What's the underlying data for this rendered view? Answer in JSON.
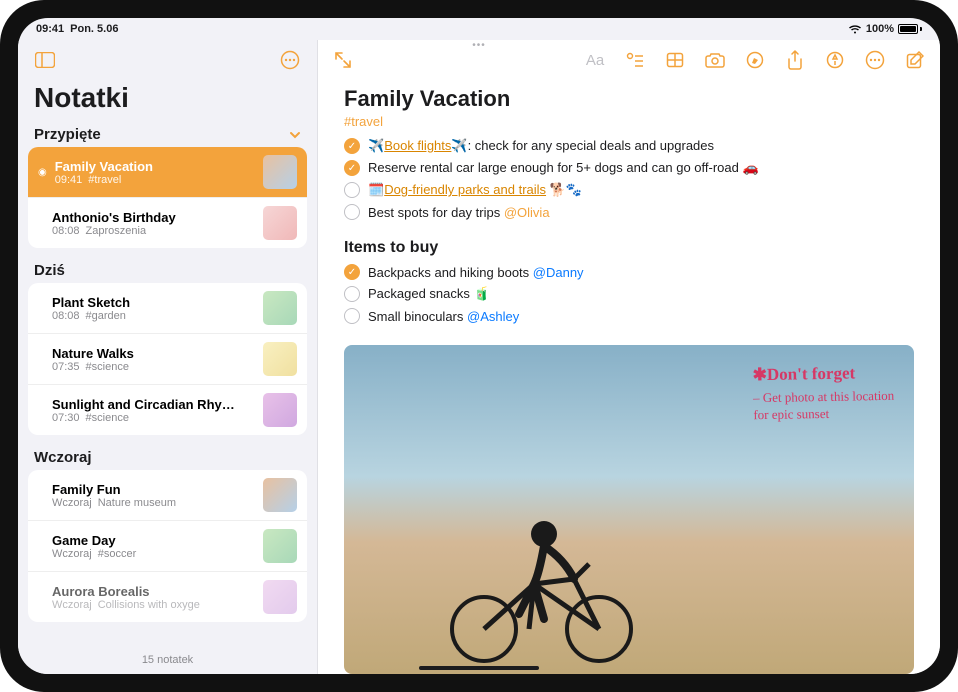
{
  "statusbar": {
    "time": "09:41",
    "date": "Pon. 5.06",
    "battery": "100%"
  },
  "sidebar": {
    "title": "Notatki",
    "sections": [
      {
        "header": "Przypięte",
        "items": [
          {
            "title": "Family Vacation",
            "time": "09:41",
            "preview": "#travel",
            "pinned": true,
            "selected": true
          },
          {
            "title": "Anthonio's Birthday",
            "time": "08:08",
            "preview": "Zaproszenia"
          }
        ]
      },
      {
        "header": "Dziś",
        "items": [
          {
            "title": "Plant Sketch",
            "time": "08:08",
            "preview": "#garden"
          },
          {
            "title": "Nature Walks",
            "time": "07:35",
            "preview": "#science"
          },
          {
            "title": "Sunlight and Circadian Rhy…",
            "time": "07:30",
            "preview": "#science"
          }
        ]
      },
      {
        "header": "Wczoraj",
        "items": [
          {
            "title": "Family Fun",
            "time": "Wczoraj",
            "preview": "Nature museum"
          },
          {
            "title": "Game Day",
            "time": "Wczoraj",
            "preview": "#soccer"
          },
          {
            "title": "Aurora Borealis",
            "time": "Wczoraj",
            "preview": "Collisions with oxyge"
          }
        ]
      }
    ],
    "footer": "15 notatek"
  },
  "note": {
    "title": "Family Vacation",
    "tag": "#travel",
    "checklist1": [
      {
        "done": true,
        "prefix": "✈️",
        "link": "Book flights",
        "suffix_emoji": "✈️",
        "rest": ": check for any special deals and upgrades"
      },
      {
        "done": true,
        "text": "Reserve rental car large enough for 5+ dogs and can go off-road 🚗"
      },
      {
        "done": false,
        "prefix": "🗓️",
        "link": "Dog-friendly parks and trails",
        "rest": " 🐕🐾"
      },
      {
        "done": false,
        "text": "Best spots for day trips ",
        "mention": "@Olivia"
      }
    ],
    "heading2": "Items to buy",
    "checklist2": [
      {
        "done": true,
        "text": "Backpacks and hiking boots ",
        "mention": "@Danny",
        "mblue": true
      },
      {
        "done": false,
        "text": "Packaged snacks 🧃"
      },
      {
        "done": false,
        "text": "Small binoculars ",
        "mention": "@Ashley",
        "mblue": true
      }
    ],
    "handwriting": {
      "title": "✱Don't forget",
      "line1": "– Get photo at this location",
      "line2": "for epic sunset"
    }
  }
}
